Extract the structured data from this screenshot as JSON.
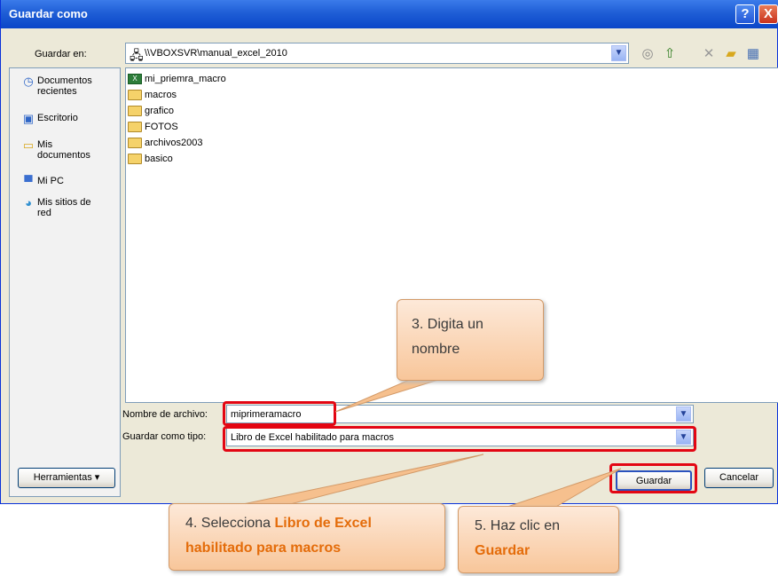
{
  "dialog": {
    "title": "Guardar como",
    "help_icon": "?",
    "close_icon": "X"
  },
  "toolbar": {
    "save_in_label": "Guardar en:",
    "location": "\\\\VBOXSVR\\manual_excel_2010",
    "icons": [
      "back-icon",
      "up-folder-icon",
      "delete-icon",
      "new-folder-icon",
      "views-icon"
    ]
  },
  "places": [
    {
      "label": "Documentos recientes",
      "icon": "recent-icon"
    },
    {
      "label": "Escritorio",
      "icon": "desktop-icon"
    },
    {
      "label": "Mis documentos",
      "icon": "my-documents-icon"
    },
    {
      "label": "Mi PC",
      "icon": "my-pc-icon"
    },
    {
      "label": "Mis sitios de red",
      "icon": "network-icon"
    }
  ],
  "files": [
    {
      "name": "mi_priemra_macro",
      "type": "excel"
    },
    {
      "name": "macros",
      "type": "folder"
    },
    {
      "name": "grafico",
      "type": "folder"
    },
    {
      "name": "FOTOS",
      "type": "folder"
    },
    {
      "name": "archivos2003",
      "type": "folder"
    },
    {
      "name": "basico",
      "type": "folder"
    }
  ],
  "filename": {
    "label": "Nombre de archivo:",
    "value": "miprimeramacro"
  },
  "filetype": {
    "label": "Guardar como tipo:",
    "value": "Libro de Excel habilitado para macros"
  },
  "buttons": {
    "tools": "Herramientas",
    "save": "Guardar",
    "cancel": "Cancelar"
  },
  "callouts": {
    "step3": "3. Digita un nombre",
    "step4_prefix": "4. Selecciona ",
    "step4_highlight": "Libro de Excel habilitado para macros",
    "step5_prefix": "5. Haz clic en",
    "step5_highlight": "Guardar"
  }
}
